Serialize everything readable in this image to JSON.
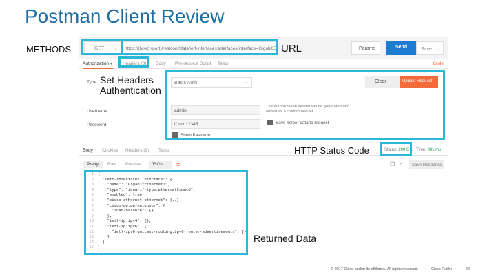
{
  "slide": {
    "title": "Postman Client Review",
    "callouts": {
      "methods": "METHODS",
      "url": "URL",
      "headers_line1": "Set Headers",
      "headers_line2": "Authentication",
      "status": "HTTP Status Code",
      "returned": "Returned Data"
    },
    "footer": {
      "copyright": "© 2017 Cisco and/or its affiliates. All rights reserved.",
      "classification": "Cisco Public",
      "page": "54"
    },
    "highlight_color": "#29b8d8"
  },
  "postman": {
    "method": "GET",
    "url": "https://{host}:{port}/restconf/data/ietf-interfaces:interfaces/interface=GigabitEthernet1?deep",
    "params_label": "Params",
    "send_label": "Send",
    "save_label": "Save",
    "request_tabs": [
      {
        "label": "Authorization",
        "active": true,
        "indicator": "●"
      },
      {
        "label": "Headers (3)",
        "active": false
      },
      {
        "label": "Body",
        "active": false
      },
      {
        "label": "Pre-request Script",
        "active": false
      },
      {
        "label": "Tests",
        "active": false
      }
    ],
    "code_link": "Code",
    "auth": {
      "type_label": "Type",
      "type_value": "Basic Auth",
      "clear_label": "Clear",
      "update_label": "Update Request",
      "username_label": "Username",
      "username_value": "admin",
      "password_label": "Password",
      "password_value": "Cisco12345",
      "note": "The authorization header will be generated and added as a custom header",
      "save_helper_label": "Save helper data to request",
      "show_password_label": "Show Password"
    },
    "response_tabs": [
      {
        "label": "Body",
        "active": true
      },
      {
        "label": "Cookies",
        "active": false
      },
      {
        "label": "Headers (9)",
        "active": false
      },
      {
        "label": "Tests",
        "active": false
      }
    ],
    "status_label": "Status:",
    "status_value": "200 OK",
    "time_label": "Time:",
    "time_value": "381 ms",
    "view_tabs": [
      {
        "label": "Pretty",
        "active": true
      },
      {
        "label": "Raw",
        "active": false
      },
      {
        "label": "Preview",
        "active": false
      }
    ],
    "format": "JSON",
    "save_response_label": "Save Response",
    "code_lines": [
      {
        "n": "1",
        "text": "{"
      },
      {
        "n": "2",
        "text": "  \"ietf-interfaces:interface\": {"
      },
      {
        "n": "3",
        "text": "    \"name\": \"GigabitEthernet1\","
      },
      {
        "n": "4",
        "text": "    \"type\": \"iana-if-type:ethernetCsmacd\","
      },
      {
        "n": "5",
        "text": "    \"enabled\": true,"
      },
      {
        "n": "6",
        "text": "    \"cisco-ethernet:ethernet\": {..},"
      },
      {
        "n": "7",
        "text": "    \"cisco-pw:pw-neighbor\": {"
      },
      {
        "n": "8",
        "text": "      \"load-balance\": {}"
      },
      {
        "n": "9",
        "text": "    },"
      },
      {
        "n": "10",
        "text": "    \"ietf-ip:ipv4\": {},"
      },
      {
        "n": "11",
        "text": "    \"ietf-ip:ipv6\": {"
      },
      {
        "n": "12",
        "text": "      \"ietf-ipv6-unicast-routing:ipv6-router-advertisements\": {}"
      },
      {
        "n": "13",
        "text": "    }"
      },
      {
        "n": "14",
        "text": "  }"
      },
      {
        "n": "15",
        "text": "}"
      }
    ]
  }
}
